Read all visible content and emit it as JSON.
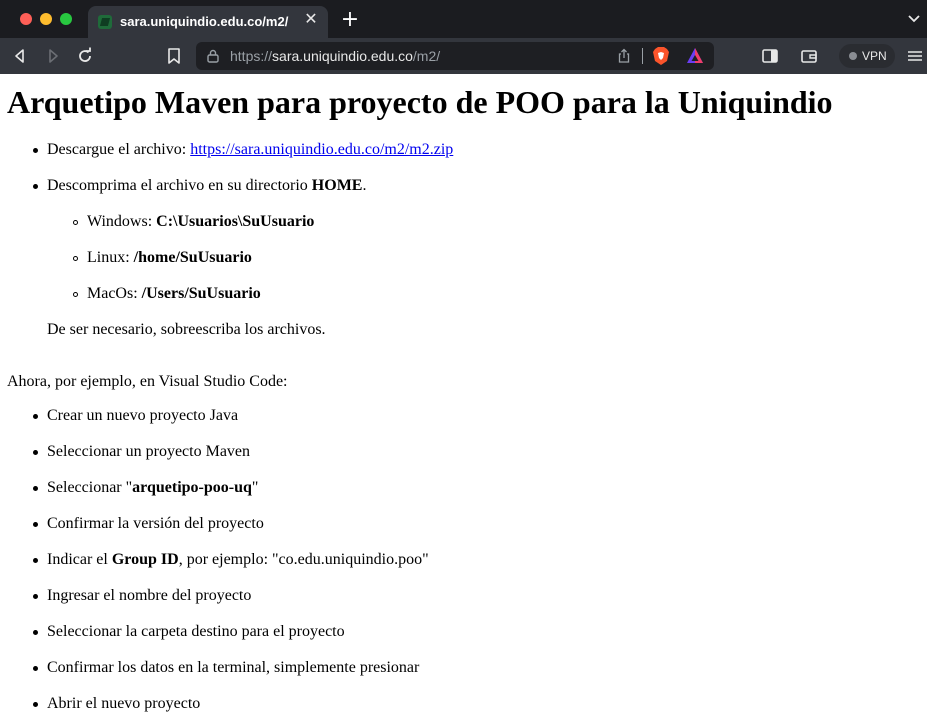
{
  "browser": {
    "tab_title": "sara.uniquindio.edu.co/m2/",
    "url": {
      "scheme": "https://",
      "host": "sara.uniquindio.edu.co",
      "path": "/m2/"
    },
    "vpn_label": "VPN"
  },
  "page": {
    "title": "Arquetipo Maven para proyecto de POO para la Uniquindio",
    "step1_prefix": "Descargue el archivo: ",
    "step1_link": "https://sara.uniquindio.edu.co/m2/m2.zip",
    "step2_prefix": "Descomprima el archivo en su directorio ",
    "step2_bold": "HOME",
    "step2_suffix": ".",
    "os_list": [
      {
        "label": "Windows: ",
        "path": "C:\\Usuarios\\SuUsuario"
      },
      {
        "label": "Linux: ",
        "path": "/home/SuUsuario"
      },
      {
        "label": "MacOs: ",
        "path": "/Users/SuUsuario"
      }
    ],
    "overwrite_note": "De ser necesario, sobreescriba los archivos.",
    "vscode_intro": "Ahora, por ejemplo, en Visual Studio Code:",
    "vscode_steps": {
      "s1": "Crear un nuevo proyecto Java",
      "s2": "Seleccionar un proyecto Maven",
      "s3_prefix": "Seleccionar \"",
      "s3_bold": "arquetipo-poo-uq",
      "s3_suffix": "\"",
      "s4": "Confirmar la versión del proyecto",
      "s5_prefix": "Indicar el ",
      "s5_bold": "Group ID",
      "s5_suffix": ", por ejemplo: \"co.edu.uniquindio.poo\"",
      "s6": "Ingresar el nombre del proyecto",
      "s7": "Seleccionar la carpeta destino para el proyecto",
      "s8": "Confirmar los datos en la terminal, simplemente presionar",
      "s9": "Abrir el nuevo proyecto"
    }
  }
}
